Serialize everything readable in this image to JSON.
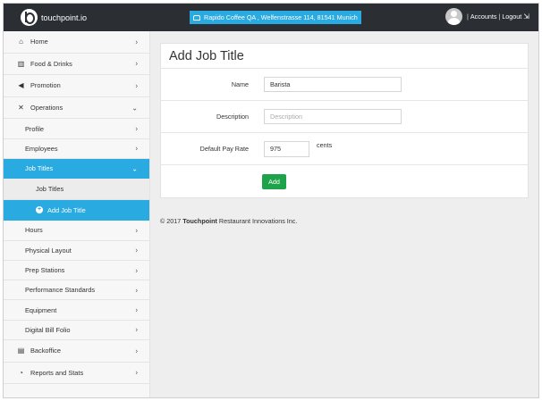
{
  "header": {
    "brand": "touchpoint.io",
    "location": "Rapido Coffee QA , Welfenstrasse 114, 81541 Munich",
    "accounts": "Accounts",
    "separator": "|",
    "logout": "Logout"
  },
  "sidebar": {
    "home": "Home",
    "food": "Food & Drinks",
    "promotion": "Promotion",
    "operations": "Operations",
    "profile": "Profile",
    "employees": "Employees",
    "job_titles": "Job Titles",
    "job_titles_sub": "Job Titles",
    "add_job_title": "Add Job Title",
    "hours": "Hours",
    "physical_layout": "Physical Layout",
    "prep_stations": "Prep Stations",
    "performance": "Performance Standards",
    "equipment": "Equipment",
    "digital_bill": "Digital Bill Folio",
    "backoffice": "Backoffice",
    "reports": "Reports and Stats"
  },
  "form": {
    "title": "Add Job Title",
    "name_label": "Name",
    "name_value": "Barista",
    "description_label": "Description",
    "description_placeholder": "Description",
    "pay_label": "Default Pay Rate",
    "pay_value": "975",
    "cents": "cents",
    "add_button": "Add"
  },
  "footer": {
    "prefix": "© 2017",
    "company": "Touchpoint",
    "suffix": "Restaurant Innovations Inc."
  },
  "colors": {
    "topbar": "#2b2e33",
    "accent": "#29aae1",
    "button": "#1fa34a"
  }
}
